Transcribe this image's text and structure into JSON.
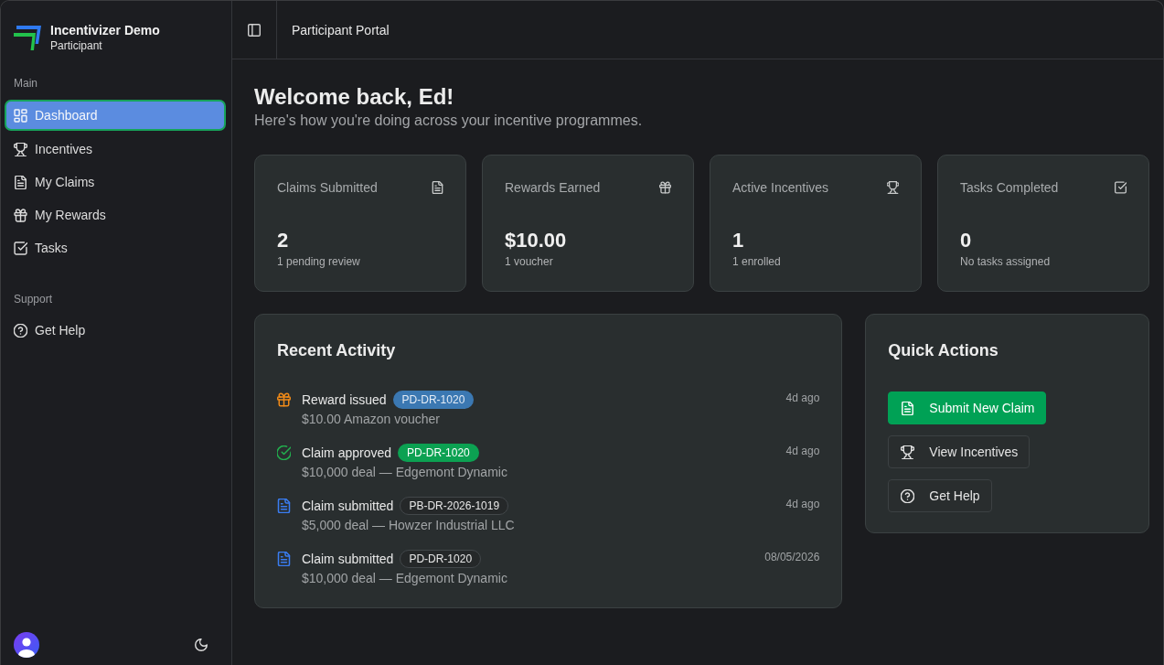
{
  "sidebar": {
    "app_name": "Incentivizer Demo",
    "role": "Participant",
    "sections": [
      {
        "heading": "Main",
        "items": [
          {
            "label": "Dashboard",
            "kind": "dashboard",
            "selected": true
          },
          {
            "label": "Incentives",
            "kind": "trophy",
            "selected": false
          },
          {
            "label": "My Claims",
            "kind": "document",
            "selected": false
          },
          {
            "label": "My Rewards",
            "kind": "gift",
            "selected": false
          },
          {
            "label": "Tasks",
            "kind": "checkbox",
            "selected": false
          }
        ]
      },
      {
        "heading": "Support",
        "items": [
          {
            "label": "Get Help",
            "kind": "help",
            "selected": false
          }
        ]
      }
    ]
  },
  "header": {
    "title": "Participant Portal"
  },
  "welcome": {
    "title": "Welcome back, Ed!",
    "subtitle": "Here's how you're doing across your incentive programmes."
  },
  "stats": [
    {
      "label": "Claims Submitted",
      "kind": "document",
      "value": "2",
      "note": "1 pending review"
    },
    {
      "label": "Rewards Earned",
      "kind": "gift",
      "value": "$10.00",
      "note": "1 voucher"
    },
    {
      "label": "Active Incentives",
      "kind": "trophy",
      "value": "1",
      "note": "1 enrolled"
    },
    {
      "label": "Tasks Completed",
      "kind": "checkbox",
      "value": "0",
      "note": "No tasks assigned"
    }
  ],
  "recent_activity": {
    "title": "Recent Activity",
    "items": [
      {
        "kind": "reward",
        "title": "Reward issued",
        "reference": "PD-DR-1020",
        "detail": "$10.00 Amazon voucher",
        "time": "4d ago"
      },
      {
        "kind": "approved",
        "title": "Claim approved",
        "reference": "PD-DR-1020",
        "detail": "$10,000 deal — Edgemont Dynamic",
        "time": "4d ago"
      },
      {
        "kind": "submitted",
        "title": "Claim submitted",
        "reference": "PB-DR-2026-1019",
        "detail": "$5,000 deal — Howzer Industrial LLC",
        "time": "4d ago"
      },
      {
        "kind": "submitted",
        "title": "Claim submitted",
        "reference": "PD-DR-1020",
        "detail": "$10,000 deal — Edgemont Dynamic",
        "time": "08/05/2026"
      }
    ]
  },
  "quick_actions": {
    "title": "Quick Actions",
    "buttons": [
      {
        "label": "Submit New Claim",
        "kind": "document",
        "primary": true
      },
      {
        "label": "View Incentives",
        "kind": "trophy",
        "primary": false
      },
      {
        "label": "Get Help",
        "kind": "help",
        "primary": false
      }
    ]
  }
}
